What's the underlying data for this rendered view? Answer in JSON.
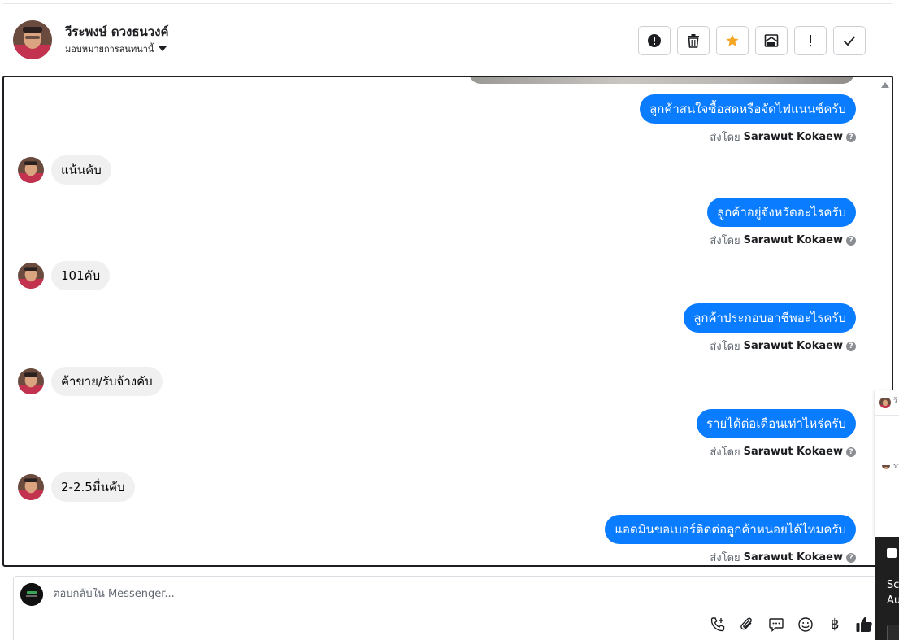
{
  "header": {
    "contact_name": "วีระพงษ์ ดวงธนวงค์",
    "assign_label": "มอบหมายการสนทนานี้",
    "toolbar": [
      {
        "name": "report-spam-button",
        "icon": "alert-circle-icon"
      },
      {
        "name": "delete-button",
        "icon": "trash-icon"
      },
      {
        "name": "star-button",
        "icon": "star-icon",
        "color": "#f5a623"
      },
      {
        "name": "mark-unread-button",
        "icon": "envelope-icon"
      },
      {
        "name": "important-button",
        "icon": "exclamation-icon"
      },
      {
        "name": "mark-done-button",
        "icon": "check-icon"
      }
    ]
  },
  "messages": [
    {
      "dir": "out",
      "text": "ลูกค้าสนใจซื้อสดหรือจัดไฟแนนซ์ครับ",
      "sent_prefix": "ส่งโดย",
      "sent_by": "Sarawut Kokaew"
    },
    {
      "dir": "in",
      "text": "แน้นคับ"
    },
    {
      "dir": "out",
      "text": "ลูกค้าอยู่จังหวัดอะไรครับ",
      "sent_prefix": "ส่งโดย",
      "sent_by": "Sarawut Kokaew"
    },
    {
      "dir": "in",
      "text": "101คับ"
    },
    {
      "dir": "out",
      "text": "ลูกค้าประกอบอาชีพอะไรครับ",
      "sent_prefix": "ส่งโดย",
      "sent_by": "Sarawut Kokaew"
    },
    {
      "dir": "in",
      "text": "ค้าขาย/รับจ้างคับ"
    },
    {
      "dir": "out",
      "text": "รายได้ต่อเดือนเท่าไหร่ครับ",
      "sent_prefix": "ส่งโดย",
      "sent_by": "Sarawut Kokaew"
    },
    {
      "dir": "in",
      "text": "2-2.5มื่นคับ"
    },
    {
      "dir": "out",
      "text": "แอดมินขอเบอร์ติดต่อลูกค้าหน่อยได้ไหมครับ",
      "sent_prefix": "ส่งโดย",
      "sent_by": "Sarawut Kokaew"
    }
  ],
  "composer": {
    "placeholder": "ตอบกลับใน Messenger...",
    "actions": [
      {
        "name": "call-button",
        "icon": "phone-plus-icon"
      },
      {
        "name": "attach-button",
        "icon": "paperclip-icon"
      },
      {
        "name": "saved-replies-button",
        "icon": "chat-bubble-icon"
      },
      {
        "name": "emoji-button",
        "icon": "smiley-icon"
      },
      {
        "name": "payment-button",
        "icon": "baht-icon",
        "glyph": "฿"
      },
      {
        "name": "like-button",
        "icon": "thumbs-up-icon"
      }
    ]
  },
  "overlay": {
    "card_text_1": "วี",
    "card_text_2": "รา",
    "toast_line_1": "Sc",
    "toast_line_2": "Au"
  },
  "colors": {
    "outgoing_bubble": "#0a7cff",
    "incoming_bubble": "#f0f0f0",
    "star": "#f5a623"
  }
}
